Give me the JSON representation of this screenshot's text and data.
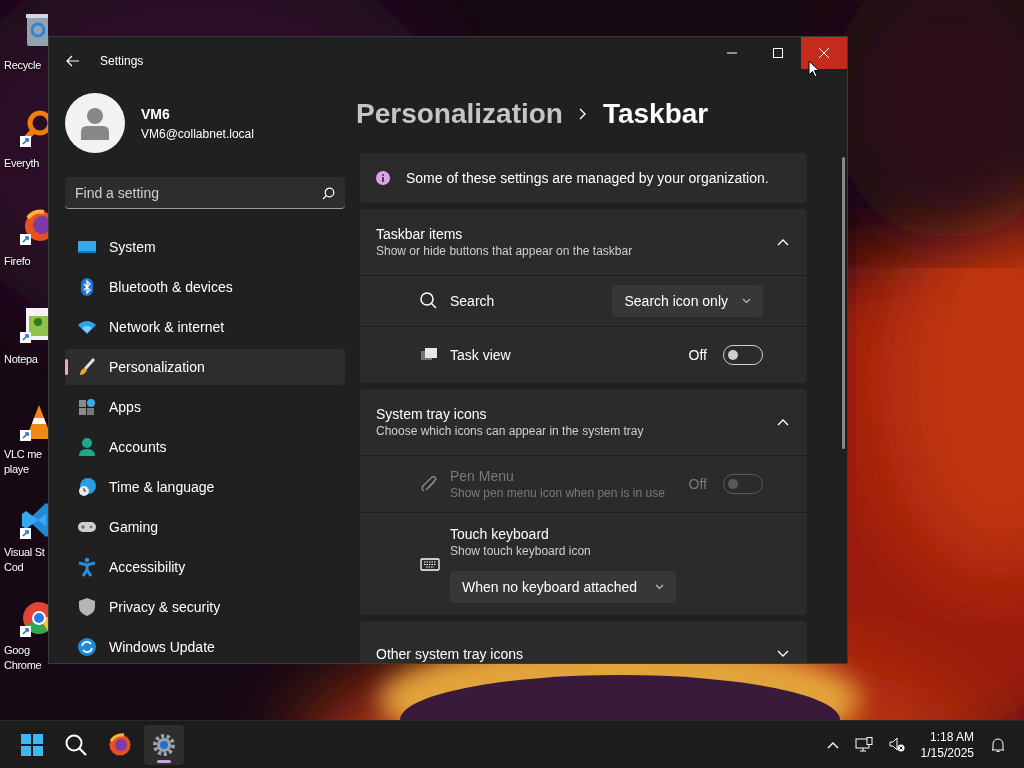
{
  "desktop_icons": [
    {
      "label": "Recycle"
    },
    {
      "label": "Everyth"
    },
    {
      "label": "Firefo"
    },
    {
      "label": "Notepa"
    },
    {
      "label": "VLC me\nplaye"
    },
    {
      "label": "Visual St\nCod"
    },
    {
      "label": "Goog\nChrome"
    }
  ],
  "window": {
    "title": "Settings"
  },
  "account": {
    "name": "VM6",
    "email": "VM6@collabnet.local"
  },
  "search": {
    "placeholder": "Find a setting"
  },
  "nav": [
    {
      "label": "System",
      "selected": false
    },
    {
      "label": "Bluetooth & devices",
      "selected": false
    },
    {
      "label": "Network & internet",
      "selected": false
    },
    {
      "label": "Personalization",
      "selected": true
    },
    {
      "label": "Apps",
      "selected": false
    },
    {
      "label": "Accounts",
      "selected": false
    },
    {
      "label": "Time & language",
      "selected": false
    },
    {
      "label": "Gaming",
      "selected": false
    },
    {
      "label": "Accessibility",
      "selected": false
    },
    {
      "label": "Privacy & security",
      "selected": false
    },
    {
      "label": "Windows Update",
      "selected": false
    }
  ],
  "breadcrumb": [
    "Personalization",
    "Taskbar"
  ],
  "notice": "Some of these settings are managed by your organization.",
  "sections": [
    {
      "title": "Taskbar items",
      "subtitle": "Show or hide buttons that appear on the taskbar",
      "expanded": true,
      "rows": [
        {
          "kind": "dropdown",
          "label": "Search",
          "value": "Search icon only",
          "disabled": false
        },
        {
          "kind": "toggle",
          "label": "Task view",
          "state_label": "Off",
          "on": false,
          "disabled": false
        }
      ]
    },
    {
      "title": "System tray icons",
      "subtitle": "Choose which icons can appear in the system tray",
      "expanded": true,
      "rows": [
        {
          "kind": "toggle",
          "label": "Pen Menu",
          "description": "Show pen menu icon when pen is in use",
          "state_label": "Off",
          "on": false,
          "disabled": true
        },
        {
          "kind": "dropdown_below",
          "label": "Touch keyboard",
          "description": "Show touch keyboard icon",
          "value": "When no keyboard attached",
          "disabled": false
        }
      ]
    },
    {
      "title": "Other system tray icons",
      "expanded": false
    }
  ],
  "taskbar": {
    "apps": [
      {
        "selected": false
      },
      {
        "selected": false
      },
      {
        "selected": false
      },
      {
        "selected": true
      }
    ],
    "time": "1:18 AM",
    "date": "1/15/2025"
  }
}
